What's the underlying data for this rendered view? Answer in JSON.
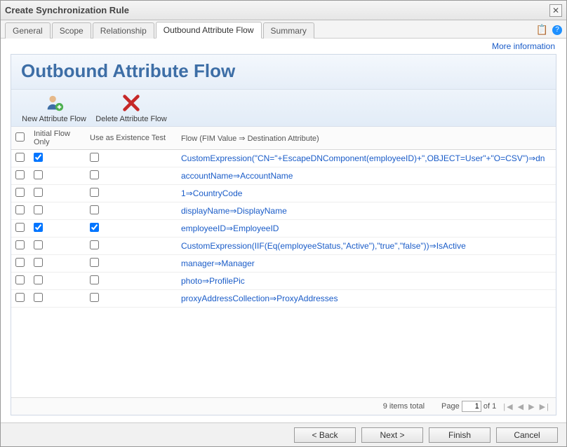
{
  "window": {
    "title": "Create Synchronization Rule",
    "close_tooltip": "Close"
  },
  "tabs": [
    {
      "label": "General",
      "active": false
    },
    {
      "label": "Scope",
      "active": false
    },
    {
      "label": "Relationship",
      "active": false
    },
    {
      "label": "Outbound Attribute Flow",
      "active": true
    },
    {
      "label": "Summary",
      "active": false
    }
  ],
  "more_info_label": "More information",
  "panel": {
    "title": "Outbound Attribute Flow"
  },
  "actions": {
    "new_label": "New Attribute Flow",
    "delete_label": "Delete Attribute Flow"
  },
  "columns": {
    "select": "",
    "initial_flow_only": "Initial Flow Only",
    "use_as_existence_test": "Use as Existence Test",
    "flow": "Flow (FIM Value ⇒ Destination Attribute)"
  },
  "rows": [
    {
      "sel": false,
      "initial": true,
      "existence": false,
      "flow": "CustomExpression(\"CN=\"+EscapeDNComponent(employeeID)+\",OBJECT=User\"+\"O=CSV\")⇒dn"
    },
    {
      "sel": false,
      "initial": false,
      "existence": false,
      "flow": "accountName⇒AccountName"
    },
    {
      "sel": false,
      "initial": false,
      "existence": false,
      "flow": "1⇒CountryCode"
    },
    {
      "sel": false,
      "initial": false,
      "existence": false,
      "flow": "displayName⇒DisplayName"
    },
    {
      "sel": false,
      "initial": true,
      "existence": true,
      "flow": "employeeID⇒EmployeeID"
    },
    {
      "sel": false,
      "initial": false,
      "existence": false,
      "flow": "CustomExpression(IIF(Eq(employeeStatus,\"Active\"),\"true\",\"false\"))⇒IsActive"
    },
    {
      "sel": false,
      "initial": false,
      "existence": false,
      "flow": "manager⇒Manager"
    },
    {
      "sel": false,
      "initial": false,
      "existence": false,
      "flow": "photo⇒ProfilePic"
    },
    {
      "sel": false,
      "initial": false,
      "existence": false,
      "flow": "proxyAddressCollection⇒ProxyAddresses"
    }
  ],
  "pager": {
    "totals": "9 items total",
    "page_label": "Page",
    "page_value": "1",
    "of_label": "of 1"
  },
  "footer": {
    "back": "< Back",
    "next": "Next >",
    "finish": "Finish",
    "cancel": "Cancel"
  }
}
